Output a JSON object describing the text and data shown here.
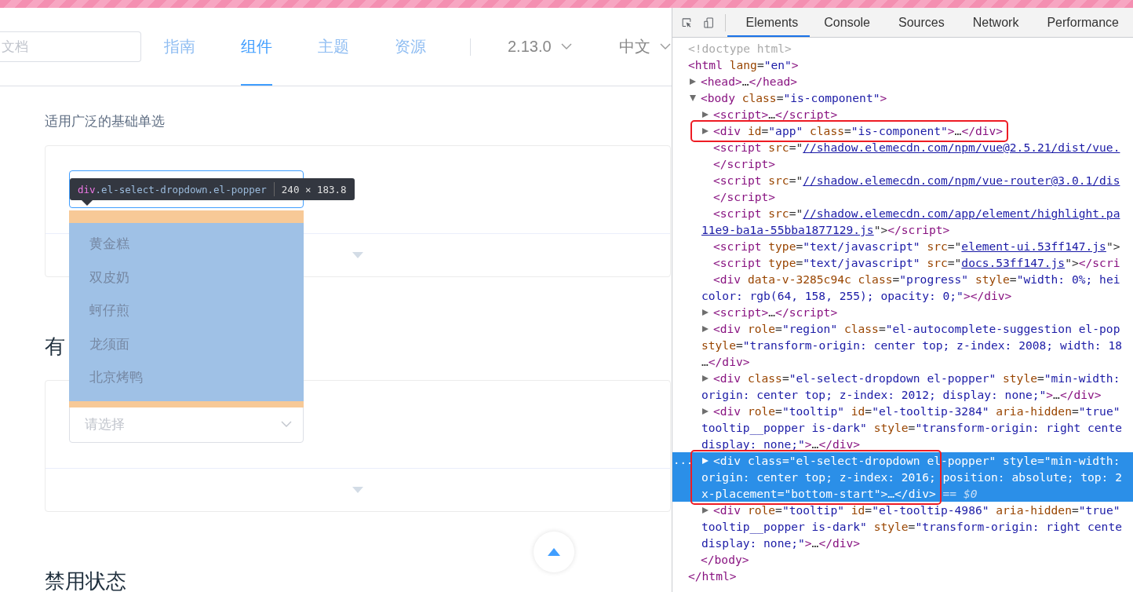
{
  "nav": {
    "search": {
      "placeholder": "文档"
    },
    "items": [
      {
        "label": "指南",
        "selected": false
      },
      {
        "label": "组件",
        "selected": true
      },
      {
        "label": "主题",
        "selected": false
      },
      {
        "label": "资源",
        "selected": false
      }
    ],
    "version": "2.13.0",
    "language": "中文"
  },
  "content": {
    "description": "适用广泛的基础单选",
    "demo_1": {
      "select": {
        "focused": true
      }
    },
    "heading_2": "有",
    "demo_2": {
      "select": {
        "placeholder": "请选择",
        "focused": false
      }
    },
    "heading_3": "禁用状态"
  },
  "inspect_tooltip": {
    "element": "div",
    "selector": ".el-select-dropdown.el-popper",
    "size": "240 × 183.8"
  },
  "dropdown_options": [
    "黄金糕",
    "双皮奶",
    "蚵仔煎",
    "龙须面",
    "北京烤鸭"
  ],
  "devtools": {
    "tabs": [
      {
        "label": "Elements",
        "selected": true
      },
      {
        "label": "Console",
        "selected": false
      },
      {
        "label": "Sources",
        "selected": false
      },
      {
        "label": "Network",
        "selected": false
      },
      {
        "label": "Performance",
        "selected": false
      }
    ],
    "dom": [
      {
        "selected": false,
        "lines": [
          [
            {
              "kind": "comment",
              "text": "<!doctype html>"
            }
          ]
        ]
      },
      {
        "selected": false,
        "lines": [
          [
            {
              "kind": "tag",
              "text": "<html"
            },
            {
              "kind": "attr",
              "text": " lang"
            },
            {
              "kind": "punct",
              "text": "="
            },
            {
              "kind": "value",
              "text": "\"en\""
            },
            {
              "kind": "tag",
              "text": ">"
            }
          ]
        ],
        "close": [
          {
            "kind": "tag",
            "text": "</html>"
          }
        ],
        "children": [
          {
            "selected": false,
            "expanded": false,
            "lines": [
              [
                {
                  "kind": "tag",
                  "text": "<head>"
                },
                {
                  "kind": "text",
                  "text": "…"
                },
                {
                  "kind": "tag",
                  "text": "</head>"
                }
              ]
            ]
          },
          {
            "selected": false,
            "expanded": true,
            "lines": [
              [
                {
                  "kind": "tag",
                  "text": "<body"
                },
                {
                  "kind": "attr",
                  "text": " class"
                },
                {
                  "kind": "punct",
                  "text": "="
                },
                {
                  "kind": "value",
                  "text": "\"is-component\""
                },
                {
                  "kind": "tag",
                  "text": ">"
                }
              ]
            ],
            "close": [
              {
                "kind": "tag",
                "text": "</body>"
              }
            ],
            "children": [
              {
                "selected": false,
                "expanded": false,
                "lines": [
                  [
                    {
                      "kind": "tag",
                      "text": "<script>"
                    },
                    {
                      "kind": "text",
                      "text": "…"
                    },
                    {
                      "kind": "tag",
                      "text": "</script>"
                    }
                  ]
                ]
              },
              {
                "selected": false,
                "expanded": false,
                "boxed": true,
                "lines": [
                  [
                    {
                      "kind": "tag",
                      "text": "<div"
                    },
                    {
                      "kind": "attr",
                      "text": " id"
                    },
                    {
                      "kind": "punct",
                      "text": "="
                    },
                    {
                      "kind": "value",
                      "text": "\"app\""
                    },
                    {
                      "kind": "attr",
                      "text": " class"
                    },
                    {
                      "kind": "punct",
                      "text": "="
                    },
                    {
                      "kind": "value",
                      "text": "\"is-component\""
                    },
                    {
                      "kind": "tag",
                      "text": ">"
                    },
                    {
                      "kind": "text",
                      "text": "…"
                    },
                    {
                      "kind": "tag",
                      "text": "</div>"
                    }
                  ]
                ]
              },
              {
                "selected": false,
                "lines": [
                  [
                    {
                      "kind": "tag",
                      "text": "<script"
                    },
                    {
                      "kind": "attr",
                      "text": " src"
                    },
                    {
                      "kind": "punct",
                      "text": "=\""
                    },
                    {
                      "kind": "link",
                      "text": "//shadow.elemecdn.com/npm/vue@2.5.21/dist/vue."
                    }
                  ]
                ],
                "close": [
                  {
                    "kind": "tag",
                    "text": "</script>"
                  }
                ]
              },
              {
                "selected": false,
                "lines": [
                  [
                    {
                      "kind": "tag",
                      "text": "<script"
                    },
                    {
                      "kind": "attr",
                      "text": " src"
                    },
                    {
                      "kind": "punct",
                      "text": "=\""
                    },
                    {
                      "kind": "link",
                      "text": "//shadow.elemecdn.com/npm/vue-router@3.0.1/dis"
                    }
                  ]
                ],
                "close": [
                  {
                    "kind": "tag",
                    "text": "</script>"
                  }
                ]
              },
              {
                "selected": false,
                "lines": [
                  [
                    {
                      "kind": "tag",
                      "text": "<script"
                    },
                    {
                      "kind": "attr",
                      "text": " src"
                    },
                    {
                      "kind": "punct",
                      "text": "=\""
                    },
                    {
                      "kind": "link",
                      "text": "//shadow.elemecdn.com/app/element/highlight.pa"
                    }
                  ],
                  [
                    {
                      "kind": "link",
                      "text": "11e9-ba1a-55bba1877129.js"
                    },
                    {
                      "kind": "punct",
                      "text": "\">"
                    },
                    {
                      "kind": "tag",
                      "text": "</script>"
                    }
                  ]
                ]
              },
              {
                "selected": false,
                "lines": [
                  [
                    {
                      "kind": "tag",
                      "text": "<script"
                    },
                    {
                      "kind": "attr",
                      "text": " type"
                    },
                    {
                      "kind": "punct",
                      "text": "="
                    },
                    {
                      "kind": "value",
                      "text": "\"text/javascript\""
                    },
                    {
                      "kind": "attr",
                      "text": " src"
                    },
                    {
                      "kind": "punct",
                      "text": "=\""
                    },
                    {
                      "kind": "link",
                      "text": "element-ui.53ff147.js"
                    },
                    {
                      "kind": "punct",
                      "text": "\">"
                    }
                  ]
                ]
              },
              {
                "selected": false,
                "lines": [
                  [
                    {
                      "kind": "tag",
                      "text": "<script"
                    },
                    {
                      "kind": "attr",
                      "text": " type"
                    },
                    {
                      "kind": "punct",
                      "text": "="
                    },
                    {
                      "kind": "value",
                      "text": "\"text/javascript\""
                    },
                    {
                      "kind": "attr",
                      "text": " src"
                    },
                    {
                      "kind": "punct",
                      "text": "=\""
                    },
                    {
                      "kind": "link",
                      "text": "docs.53ff147.js"
                    },
                    {
                      "kind": "punct",
                      "text": "\">"
                    },
                    {
                      "kind": "tag",
                      "text": "</scri"
                    }
                  ]
                ]
              },
              {
                "selected": false,
                "lines": [
                  [
                    {
                      "kind": "tag",
                      "text": "<div"
                    },
                    {
                      "kind": "attr",
                      "text": " data-v-3285c94c"
                    },
                    {
                      "kind": "attr",
                      "text": " class"
                    },
                    {
                      "kind": "punct",
                      "text": "="
                    },
                    {
                      "kind": "value",
                      "text": "\"progress\""
                    },
                    {
                      "kind": "attr",
                      "text": " style"
                    },
                    {
                      "kind": "punct",
                      "text": "="
                    },
                    {
                      "kind": "value",
                      "text": "\"width: 0%; hei"
                    }
                  ],
                  [
                    {
                      "kind": "value",
                      "text": "color: rgb(64, 158, 255); opacity: 0;\""
                    },
                    {
                      "kind": "tag",
                      "text": "></div>"
                    }
                  ]
                ]
              },
              {
                "selected": false,
                "expanded": false,
                "lines": [
                  [
                    {
                      "kind": "tag",
                      "text": "<script>"
                    },
                    {
                      "kind": "text",
                      "text": "…"
                    },
                    {
                      "kind": "tag",
                      "text": "</script>"
                    }
                  ]
                ]
              },
              {
                "selected": false,
                "expanded": false,
                "lines": [
                  [
                    {
                      "kind": "tag",
                      "text": "<div"
                    },
                    {
                      "kind": "attr",
                      "text": " role"
                    },
                    {
                      "kind": "punct",
                      "text": "="
                    },
                    {
                      "kind": "value",
                      "text": "\"region\""
                    },
                    {
                      "kind": "attr",
                      "text": " class"
                    },
                    {
                      "kind": "punct",
                      "text": "="
                    },
                    {
                      "kind": "value",
                      "text": "\"el-autocomplete-suggestion el-pop"
                    }
                  ],
                  [
                    {
                      "kind": "attr",
                      "text": "style"
                    },
                    {
                      "kind": "punct",
                      "text": "="
                    },
                    {
                      "kind": "value",
                      "text": "\"transform-origin: center top; z-index: 2008; width: 18"
                    }
                  ],
                  [
                    {
                      "kind": "text",
                      "text": "…"
                    },
                    {
                      "kind": "tag",
                      "text": "</div>"
                    }
                  ]
                ]
              },
              {
                "selected": false,
                "expanded": false,
                "lines": [
                  [
                    {
                      "kind": "tag",
                      "text": "<div"
                    },
                    {
                      "kind": "attr",
                      "text": " class"
                    },
                    {
                      "kind": "punct",
                      "text": "="
                    },
                    {
                      "kind": "value",
                      "text": "\"el-select-dropdown el-popper\""
                    },
                    {
                      "kind": "attr",
                      "text": " style"
                    },
                    {
                      "kind": "punct",
                      "text": "="
                    },
                    {
                      "kind": "value",
                      "text": "\"min-width:"
                    }
                  ],
                  [
                    {
                      "kind": "value",
                      "text": "origin: center top; z-index: 2012; display: none;\""
                    },
                    {
                      "kind": "tag",
                      "text": ">"
                    },
                    {
                      "kind": "text",
                      "text": "…"
                    },
                    {
                      "kind": "tag",
                      "text": "</div>"
                    }
                  ]
                ]
              },
              {
                "selected": false,
                "expanded": false,
                "lines": [
                  [
                    {
                      "kind": "tag",
                      "text": "<div"
                    },
                    {
                      "kind": "attr",
                      "text": " role"
                    },
                    {
                      "kind": "punct",
                      "text": "="
                    },
                    {
                      "kind": "value",
                      "text": "\"tooltip\""
                    },
                    {
                      "kind": "attr",
                      "text": " id"
                    },
                    {
                      "kind": "punct",
                      "text": "="
                    },
                    {
                      "kind": "value",
                      "text": "\"el-tooltip-3284\""
                    },
                    {
                      "kind": "attr",
                      "text": " aria-hidden"
                    },
                    {
                      "kind": "punct",
                      "text": "="
                    },
                    {
                      "kind": "value",
                      "text": "\"true\""
                    }
                  ],
                  [
                    {
                      "kind": "value",
                      "text": "tooltip__popper is-dark\""
                    },
                    {
                      "kind": "attr",
                      "text": " style"
                    },
                    {
                      "kind": "punct",
                      "text": "="
                    },
                    {
                      "kind": "value",
                      "text": "\"transform-origin: right cente"
                    }
                  ],
                  [
                    {
                      "kind": "value",
                      "text": "display: none;\""
                    },
                    {
                      "kind": "tag",
                      "text": ">"
                    },
                    {
                      "kind": "text",
                      "text": "…"
                    },
                    {
                      "kind": "tag",
                      "text": "</div>"
                    }
                  ]
                ]
              },
              {
                "selected": true,
                "expanded": false,
                "boxed": true,
                "more": "...",
                "lines": [
                  [
                    {
                      "kind": "tag",
                      "text": "<div"
                    },
                    {
                      "kind": "attr",
                      "text": " class"
                    },
                    {
                      "kind": "punct",
                      "text": "="
                    },
                    {
                      "kind": "value",
                      "text": "\"el-select-dropdown el-popper\""
                    },
                    {
                      "kind": "attr",
                      "text": " style"
                    },
                    {
                      "kind": "punct",
                      "text": "="
                    },
                    {
                      "kind": "value",
                      "text": "\"min-width:"
                    }
                  ],
                  [
                    {
                      "kind": "value",
                      "text": "origin: center top; z-index: 2016; position: absolute; top: 2"
                    }
                  ],
                  [
                    {
                      "kind": "attr",
                      "text": "x-placement"
                    },
                    {
                      "kind": "punct",
                      "text": "="
                    },
                    {
                      "kind": "value",
                      "text": "\"bottom-start\""
                    },
                    {
                      "kind": "tag",
                      "text": ">"
                    },
                    {
                      "kind": "text",
                      "text": "…"
                    },
                    {
                      "kind": "tag",
                      "text": "</div>"
                    },
                    {
                      "kind": "ref",
                      "text": " == $0"
                    }
                  ]
                ]
              },
              {
                "selected": false,
                "expanded": false,
                "lines": [
                  [
                    {
                      "kind": "tag",
                      "text": "<div"
                    },
                    {
                      "kind": "attr",
                      "text": " role"
                    },
                    {
                      "kind": "punct",
                      "text": "="
                    },
                    {
                      "kind": "value",
                      "text": "\"tooltip\""
                    },
                    {
                      "kind": "attr",
                      "text": " id"
                    },
                    {
                      "kind": "punct",
                      "text": "="
                    },
                    {
                      "kind": "value",
                      "text": "\"el-tooltip-4986\""
                    },
                    {
                      "kind": "attr",
                      "text": " aria-hidden"
                    },
                    {
                      "kind": "punct",
                      "text": "="
                    },
                    {
                      "kind": "value",
                      "text": "\"true\""
                    }
                  ],
                  [
                    {
                      "kind": "value",
                      "text": "tooltip__popper is-dark\""
                    },
                    {
                      "kind": "attr",
                      "text": " style"
                    },
                    {
                      "kind": "punct",
                      "text": "="
                    },
                    {
                      "kind": "value",
                      "text": "\"transform-origin: right cente"
                    }
                  ],
                  [
                    {
                      "kind": "value",
                      "text": "display: none;\""
                    },
                    {
                      "kind": "tag",
                      "text": ">"
                    },
                    {
                      "kind": "text",
                      "text": "…"
                    },
                    {
                      "kind": "tag",
                      "text": "</div>"
                    }
                  ]
                ]
              }
            ]
          }
        ]
      }
    ]
  }
}
